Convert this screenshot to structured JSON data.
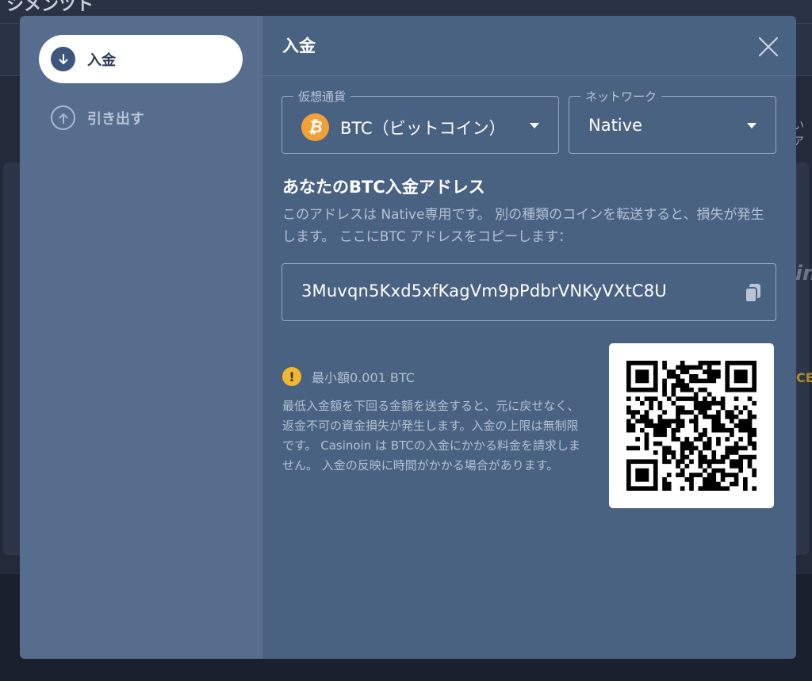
{
  "background": {
    "title": "シメンツト",
    "peek_text_1": "いア",
    "peek_text_2": "in",
    "peek_text_3": "CE"
  },
  "sidebar": {
    "items": [
      {
        "label": "入金",
        "icon": "arrow-down-circle-icon",
        "active": true
      },
      {
        "label": "引き出す",
        "icon": "arrow-up-circle-icon",
        "active": false
      }
    ]
  },
  "main": {
    "title": "入金",
    "currency_select": {
      "legend": "仮想通貨",
      "value": "BTC（ビットコイン）",
      "icon": "bitcoin-icon",
      "coin_symbol": "₿"
    },
    "network_select": {
      "legend": "ネットワーク",
      "value": "Native"
    },
    "address_heading": "あなたのBTC入金アドレス",
    "address_description": "このアドレスは Native専用です。 別の種類のコインを転送すると、損失が発生します。 ここにBTC アドレスをコピーします：",
    "address_value": "3Muvqn5Kxd5xfKagVm9pPdbrVNKyVXtC8U",
    "minimum": {
      "icon_glyph": "!",
      "label": "最小額0.001 BTC",
      "description": "最低入金額を下回る金額を送金すると、元に戻せなく、返金不可の資金損失が発生します。入金の上限は無制限です。 Casinoin は BTCの入金にかかる料金を請求しません。 入金の反映に時間がかかる場合があります。"
    }
  },
  "colors": {
    "sidebar_bg": "#566d8e",
    "main_bg": "#4a6282",
    "accent_bitcoin": "#f0a138",
    "warning": "#f2b72d",
    "nav_active_icon": "#3e567c"
  }
}
